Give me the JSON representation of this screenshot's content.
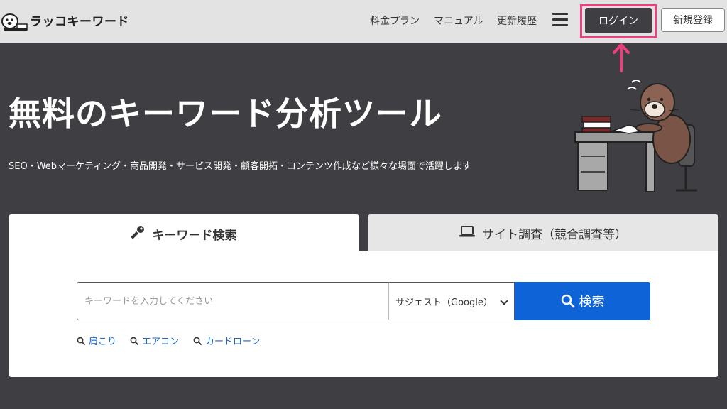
{
  "header": {
    "logo_text": "ラッコキーワード",
    "nav": [
      "料金プラン",
      "マニュアル",
      "更新履歴"
    ],
    "login_label": "ログイン",
    "signup_label": "新規登録"
  },
  "hero": {
    "title": "無料のキーワード分析ツール",
    "subtitle": "SEO・Webマーケティング・商品開発・サービス開発・顧客開拓・コンテンツ作成など様々な場面で活躍します"
  },
  "tabs": [
    {
      "label": "キーワード検索",
      "icon": "key-icon",
      "active": true
    },
    {
      "label": "サイト調査（競合調査等）",
      "icon": "laptop-icon",
      "active": false
    }
  ],
  "search": {
    "placeholder": "キーワードを入力してください",
    "value": "",
    "select_value": "サジェスト（Google）",
    "button_label": "検索"
  },
  "suggestions": [
    "肩こり",
    "エアコン",
    "カードローン"
  ],
  "colors": {
    "header_bg": "#e3e3e3",
    "page_bg": "#3f3f43",
    "accent_blue": "#0e63d6",
    "highlight_pink": "#ec3f80"
  }
}
